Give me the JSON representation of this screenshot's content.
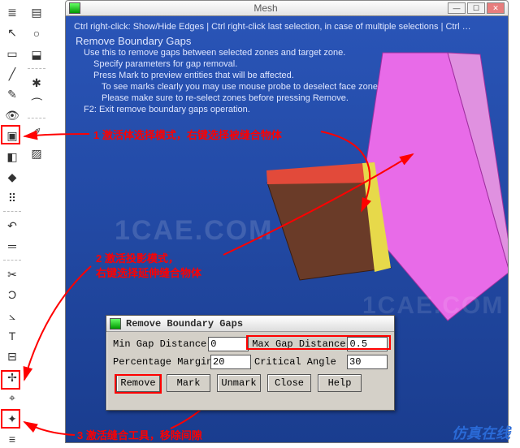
{
  "window": {
    "title": "Mesh"
  },
  "hints": {
    "line1": "Ctrl right-click: Show/Hide Edges | Ctrl right-click last selection, in case of multiple selections | Ctrl …",
    "line2": "Remove Boundary Gaps",
    "line3": "Use this to remove gaps between selected zones and target zone.",
    "line4": "Specify parameters for gap removal.",
    "line5": "Press Mark to preview entities that will be affected.",
    "line6": "To see marks clearly you may use mouse probe to deselect face zones.",
    "line7": "Please make sure to re-select zones before pressing Remove.",
    "line8": "F2: Exit remove boundary gaps operation."
  },
  "annotations": {
    "a1": "1 激活体选择模式，右键选择被缝合物体",
    "a2_l1": "2 激活投影模式，",
    "a2_l2": "右键选择延伸缝合物体",
    "a3": "3 激活缝合工具，移除间隙"
  },
  "dialog": {
    "title": "Remove Boundary Gaps",
    "min_label": "Min Gap Distance",
    "min_value": "0",
    "max_label": "Max Gap Distance",
    "max_value": "0.5",
    "pct_label": "Percentage Margin",
    "pct_value": "20",
    "ang_label": "Critical Angle",
    "ang_value": "30",
    "btn_remove": "Remove",
    "btn_mark": "Mark",
    "btn_unmark": "Unmark",
    "btn_close": "Close",
    "btn_help": "Help"
  },
  "watermark": {
    "text": "1CAE.COM"
  },
  "brand": "仿真在线",
  "icons": {
    "simplify": "≣",
    "cursor": "↖",
    "select": "▭",
    "segment": "╱",
    "sketch": "✎",
    "eye": "👁",
    "screen": "▣",
    "cube": "◧",
    "shape": "◆",
    "dots": "⠿",
    "undo": "↶",
    "gap": "═",
    "clip": "✂",
    "curve": "Ɔ",
    "angle": "⦣",
    "text": "T",
    "tree": "⊟",
    "spark": "✢",
    "target": "⌖",
    "wand": "✦",
    "align": "≡",
    "drum": "▤",
    "sphere": "○",
    "cylinder": "⬓",
    "fan": "✱",
    "lashes": "⏜",
    "pencil": "✐",
    "box3d": "▨"
  }
}
